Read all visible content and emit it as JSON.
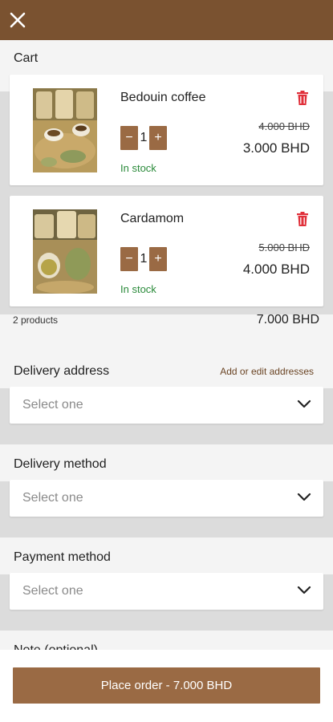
{
  "header": {
    "close_icon": "close-icon",
    "accent_color": "#7a5230"
  },
  "cart": {
    "title": "Cart",
    "items": [
      {
        "name": "Bedouin coffee",
        "quantity": "1",
        "old_price": "4.000 BHD",
        "price": "3.000 BHD",
        "stock": "In stock",
        "decrement_label": "−",
        "increment_label": "+"
      },
      {
        "name": "Cardamom",
        "quantity": "1",
        "old_price": "5.000 BHD",
        "price": "4.000 BHD",
        "stock": "In stock",
        "decrement_label": "−",
        "increment_label": "+"
      }
    ],
    "summary": {
      "count": "2 products",
      "total": "7.000 BHD"
    }
  },
  "delivery_address": {
    "label": "Delivery address",
    "link": "Add or edit addresses",
    "placeholder": "Select one"
  },
  "delivery_method": {
    "label": "Delivery method",
    "placeholder": "Select one"
  },
  "payment_method": {
    "label": "Payment method",
    "placeholder": "Select one"
  },
  "note": {
    "label": "Note (optional)"
  },
  "footer": {
    "place_order": "Place order - 7.000 BHD",
    "button_color": "#9a6a44"
  },
  "colors": {
    "stock": "#2a8a3a",
    "trash": "#e0303a",
    "background": "#dcdcdc"
  }
}
